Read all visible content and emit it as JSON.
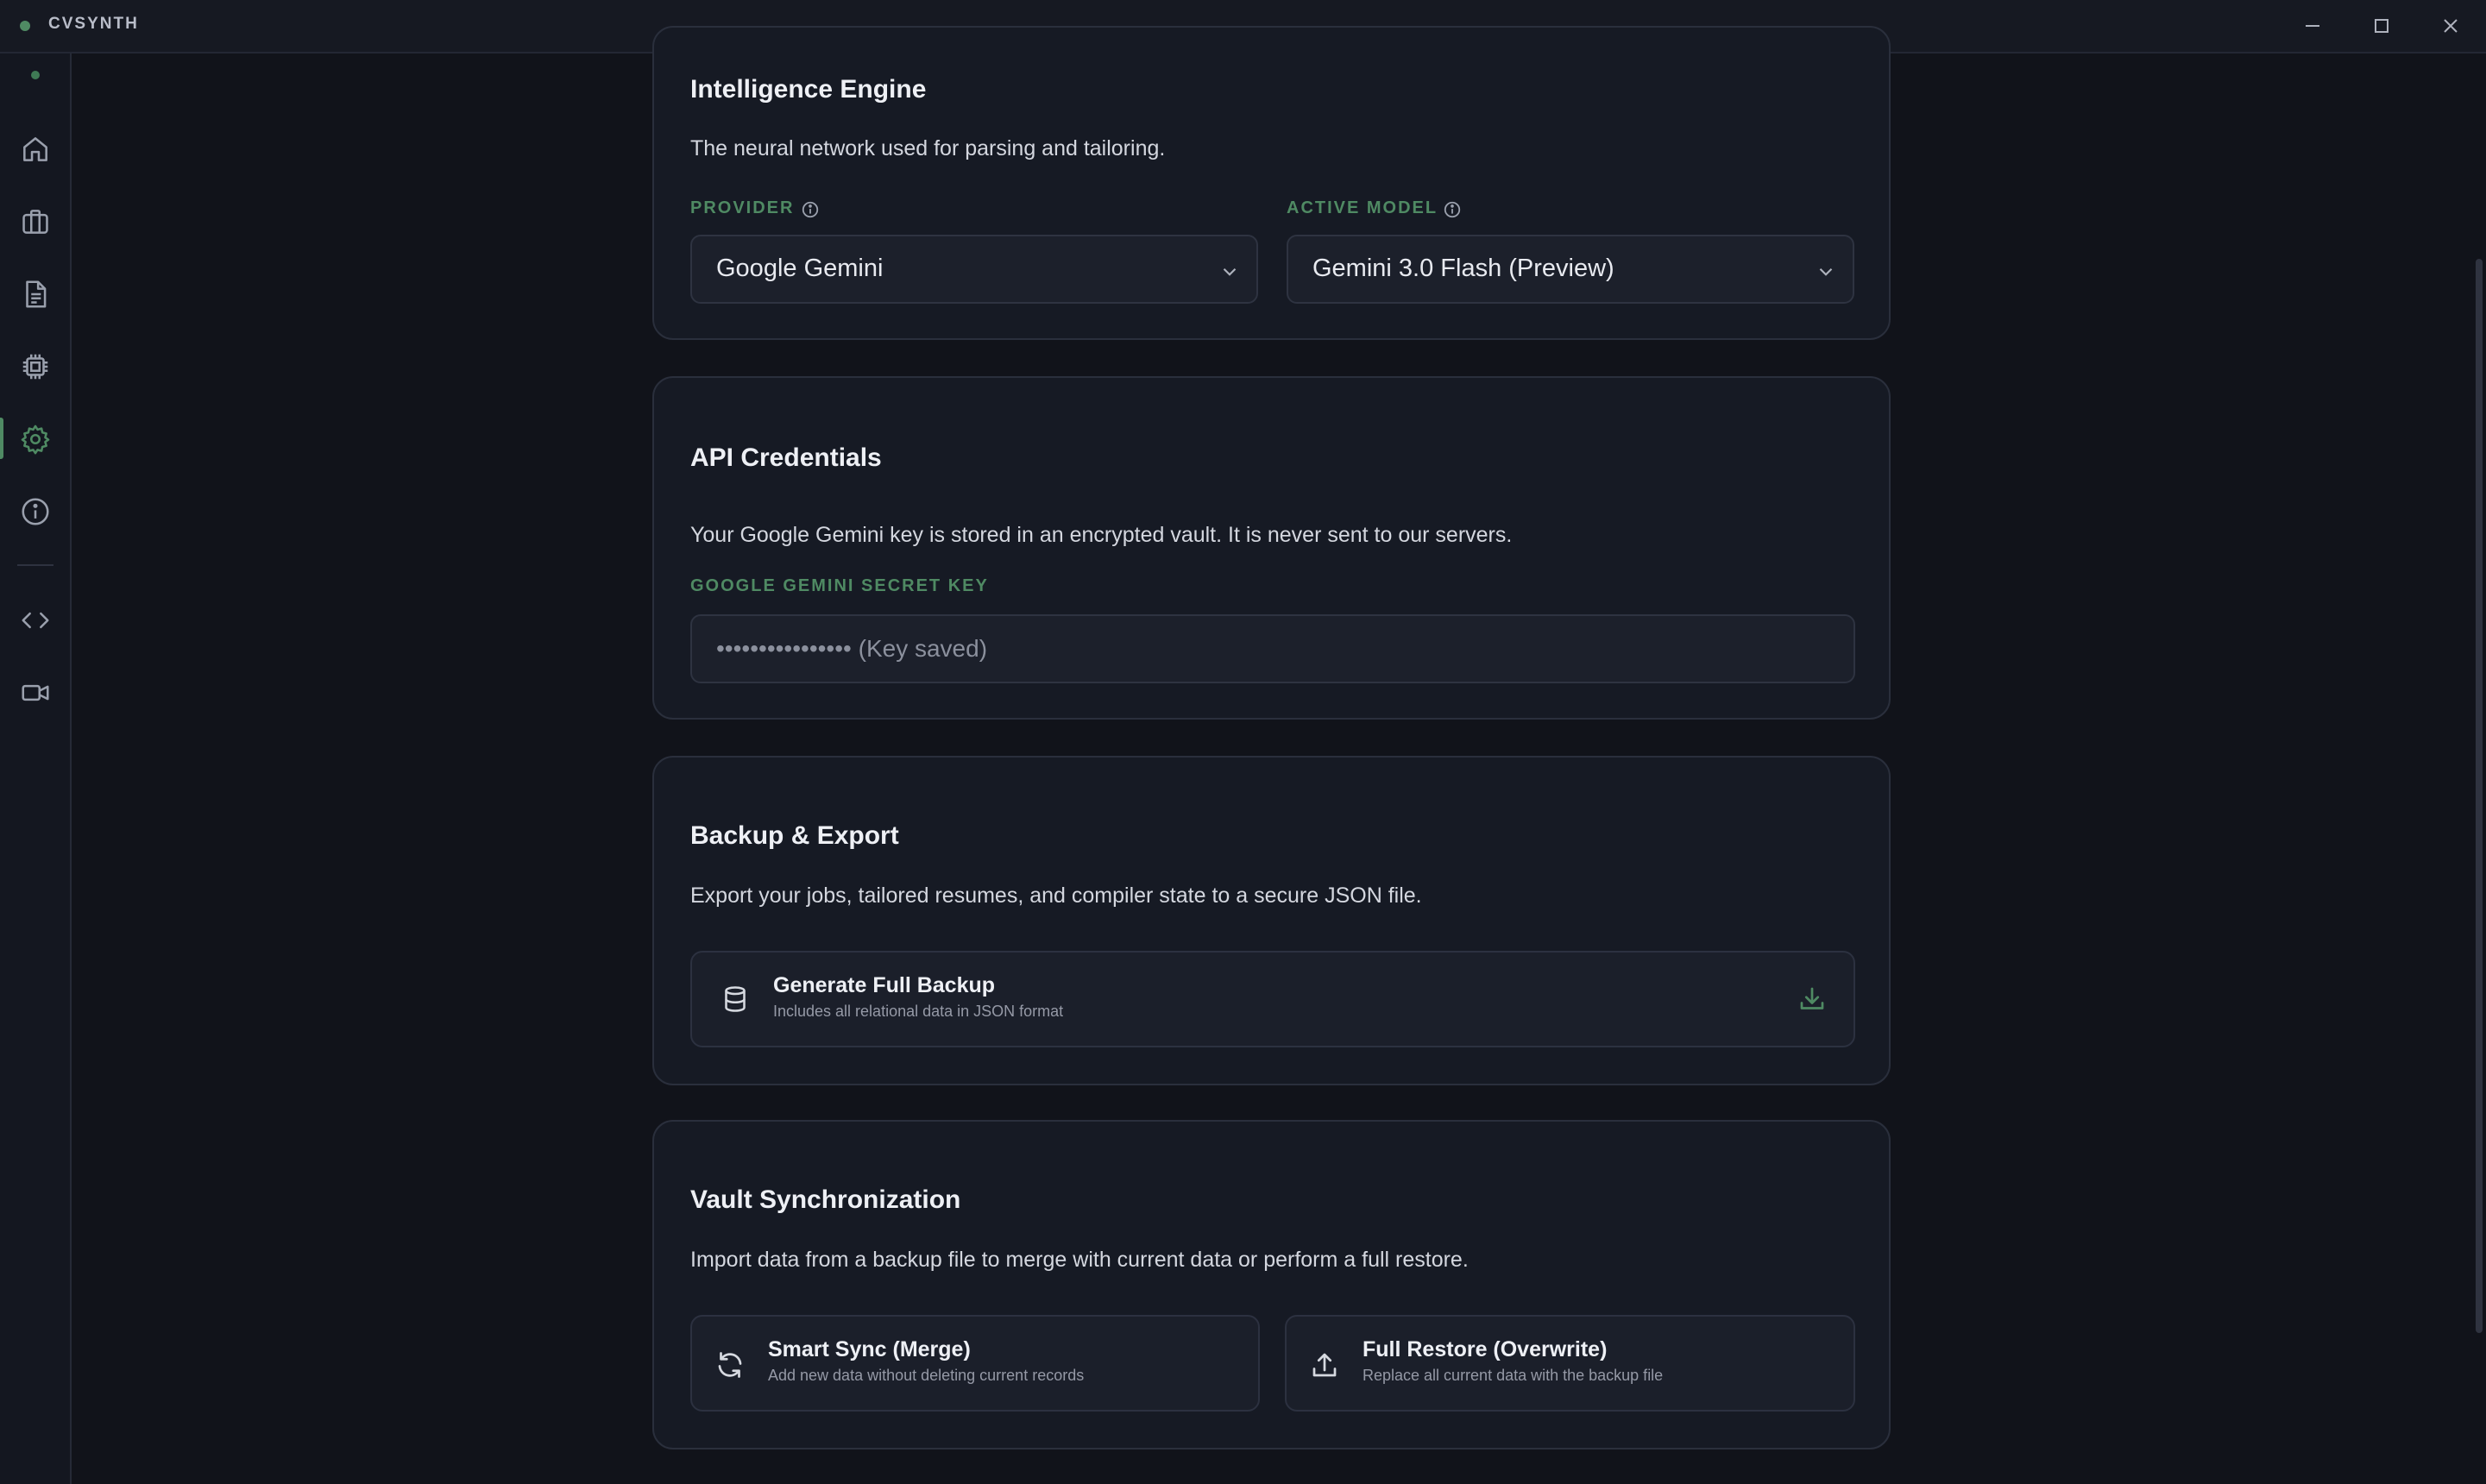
{
  "window": {
    "title": "CVSYNTH",
    "controls": [
      "minimize-icon",
      "maximize-icon",
      "close-icon"
    ]
  },
  "sidebar": {
    "items": [
      {
        "icon": "home-icon",
        "active": false
      },
      {
        "icon": "briefcase-icon",
        "active": false
      },
      {
        "icon": "document-icon",
        "active": false
      },
      {
        "icon": "cpu-chip-icon",
        "active": false
      },
      {
        "icon": "gear-icon",
        "active": true
      },
      {
        "icon": "info-icon",
        "active": false
      },
      {
        "icon": "code-icon",
        "active": false
      },
      {
        "icon": "video-camera-icon",
        "active": false
      }
    ]
  },
  "intelligence": {
    "title": "Intelligence Engine",
    "description": "The neural network used for parsing and tailoring.",
    "provider_label": "PROVIDER",
    "provider_value": "Google Gemini",
    "model_label": "ACTIVE MODEL",
    "model_value": "Gemini 3.0 Flash (Preview)"
  },
  "credentials": {
    "title": "API Credentials",
    "description": "Your Google Gemini key is stored in an encrypted vault. It is never sent to our servers.",
    "key_label": "GOOGLE GEMINI SECRET KEY",
    "key_placeholder": "•••••••••••••••• (Key saved)"
  },
  "backup": {
    "title": "Backup & Export",
    "description": "Export your jobs, tailored resumes, and compiler state to a secure JSON file.",
    "action_title": "Generate Full Backup",
    "action_subtitle": "Includes all relational data in JSON format"
  },
  "vault": {
    "title": "Vault Synchronization",
    "description": "Import data from a backup file to merge with current data or perform a full restore.",
    "merge_title": "Smart Sync (Merge)",
    "merge_subtitle": "Add new data without deleting current records",
    "restore_title": "Full Restore (Overwrite)",
    "restore_subtitle": "Replace all current data with the backup file"
  },
  "colors": {
    "accent": "#4f8a63",
    "background": "#11131a",
    "card": "#161a24"
  }
}
